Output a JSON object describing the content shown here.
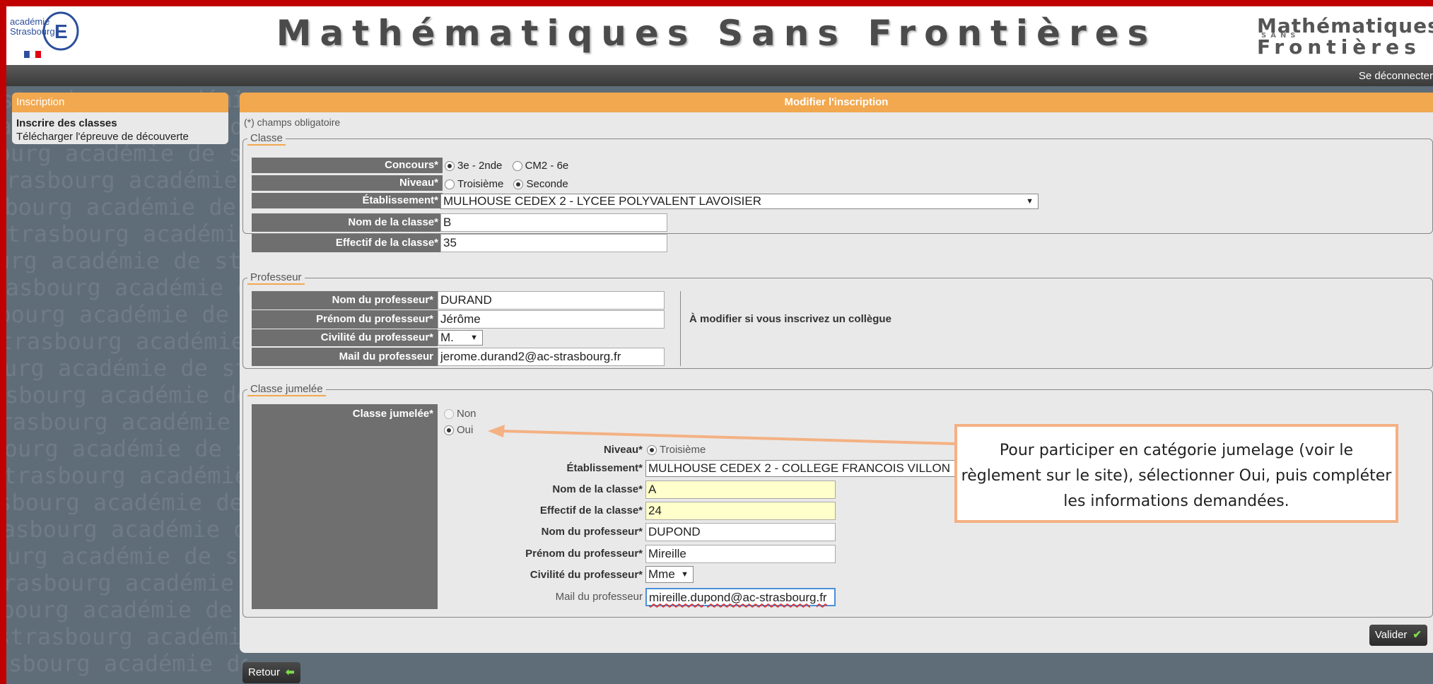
{
  "header": {
    "site_title": "Mathématiques Sans Frontières",
    "academie_logo_text": "académie Strasbourg",
    "msf_logo_line1": "Mathématiques",
    "msf_logo_sans": "SANS",
    "msf_logo_line2": "Frontières"
  },
  "topbar": {
    "logout_label": "Se déconnecter"
  },
  "sidebar": {
    "header": "Inscription",
    "items": [
      {
        "label": "Inscrire des classes",
        "active": true
      },
      {
        "label": "Télécharger l'épreuve de découverte",
        "active": false
      }
    ]
  },
  "main": {
    "title": "Modifier l'inscription",
    "required_note": "(*) champs obligatoire",
    "classe": {
      "legend": "Classe",
      "concours_label": "Concours*",
      "concours_options": [
        "3e - 2nde",
        "CM2 - 6e"
      ],
      "concours_selected": "3e - 2nde",
      "niveau_label": "Niveau*",
      "niveau_options": [
        "Troisième",
        "Seconde"
      ],
      "niveau_selected": "Seconde",
      "etablissement_label": "Établissement*",
      "etablissement_value": "MULHOUSE CEDEX 2 - LYCEE POLYVALENT LAVOISIER",
      "nom_classe_label": "Nom de la classe*",
      "nom_classe_value": "B",
      "effectif_label": "Effectif de la classe*",
      "effectif_value": "35"
    },
    "professeur": {
      "legend": "Professeur",
      "nom_label": "Nom du professeur*",
      "nom_value": "DURAND",
      "prenom_label": "Prénom du professeur*",
      "prenom_value": "Jérôme",
      "civilite_label": "Civilité du professeur*",
      "civilite_value": "M.",
      "mail_label": "Mail du professeur",
      "mail_value": "jerome.durand2@ac-strasbourg.fr",
      "note": "À modifier si vous inscrivez un collègue"
    },
    "jumelee": {
      "legend": "Classe jumelée",
      "label": "Classe jumelée*",
      "options": [
        "Non",
        "Oui"
      ],
      "selected": "Oui",
      "niveau_label": "Niveau*",
      "niveau_value": "Troisième",
      "etablissement_label": "Établissement*",
      "etablissement_value": "MULHOUSE CEDEX 2 - COLLEGE FRANCOIS VILLON",
      "nom_classe_label": "Nom de la classe*",
      "nom_classe_value": "A",
      "effectif_label": "Effectif de la classe*",
      "effectif_value": "24",
      "nom_prof_label": "Nom du professeur*",
      "nom_prof_value": "DUPOND",
      "prenom_prof_label": "Prénom du professeur*",
      "prenom_prof_value": "Mireille",
      "civilite_label": "Civilité du professeur*",
      "civilite_value": "Mme",
      "mail_label": "Mail du professeur",
      "mail_value": "mireille.dupond@ac-strasbourg.fr"
    },
    "callout_text": "Pour participer en catégorie jumelage (voir le règlement sur le site), sélectionner  Oui, puis compléter les informations demandées.",
    "valider_label": "Valider",
    "retour_label": "Retour"
  },
  "background": {
    "watermark_text": "strasbourg académie de strasbourg académie"
  },
  "colors": {
    "accent": "#f2a84f",
    "frame": "#c00000",
    "label_bg": "#6f6f6f"
  }
}
